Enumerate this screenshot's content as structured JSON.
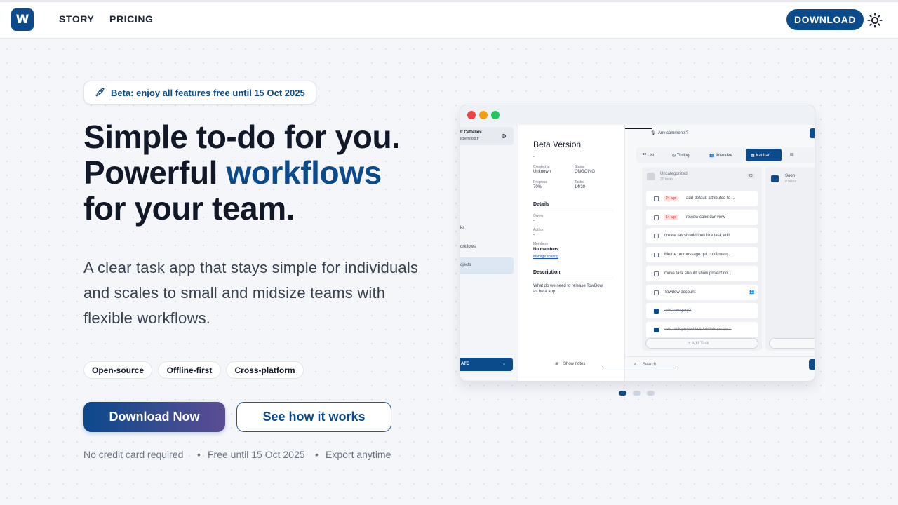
{
  "header": {
    "logo_letter": "W",
    "nav": [
      "STORY",
      "PRICING"
    ],
    "download_label": "DOWNLOAD",
    "theme_icon": "sun-icon"
  },
  "hero": {
    "badge_icon": "rocket-icon",
    "badge_text": "Beta: enjoy all features free until 15 Oct 2025",
    "title_line1": "Simple to-do for you.",
    "title_line2_a": "Powerful ",
    "title_line2_b": "workflows",
    "title_line3": "for your team.",
    "subtitle": "A clear task app that stays simple for individuals and scales to small and midsize teams with flexible workflows.",
    "chips": [
      "Open-source",
      "Offline-first",
      "Cross-platform"
    ],
    "primary_cta": "Download Now",
    "secondary_cta": "See how it works",
    "notes": [
      "No credit card required",
      "Free until 15 Oct 2025",
      "Export anytime"
    ],
    "note_separator": "•"
  },
  "app_preview": {
    "sidebar": {
      "user_name": "lt Cattelani",
      "user_email": "j@emocio.fr",
      "items": [
        "ks",
        "orkflows",
        "ojects"
      ],
      "create_label": "ATE"
    },
    "detail": {
      "title": "Beta Version",
      "dash": "-",
      "created_label": "Created at",
      "created_value": "Unknown",
      "status_label": "Status",
      "status_value": "ONGOING",
      "progress_label": "Progress",
      "progress_value": "70%",
      "tasks_label": "Tasks",
      "tasks_value": "14/20",
      "details_heading": "Details",
      "owner_label": "Owner",
      "owner_value": "-",
      "author_label": "Author",
      "author_value": "-",
      "members_label": "Members",
      "members_value": "No members",
      "manage_link": "Manage sharing",
      "description_heading": "Description",
      "description_text": "What do we need to release TowDow as beta app",
      "show_notes": "Show notes"
    },
    "board": {
      "comments_placeholder": "Any comments?",
      "views": [
        "List",
        "Timing",
        "Attendee",
        "Kanban"
      ],
      "active_view": "Kanban",
      "col1_title": "Uncategorized",
      "col1_count_text": "20 tasks",
      "col1_count_badge": "20",
      "tasks": [
        {
          "title": "add default attributed to ...",
          "tag": "24 ago",
          "done": false
        },
        {
          "title": "review calendar view",
          "tag": "14 ago",
          "done": false
        },
        {
          "title": "create tas should look like task edit",
          "tag": "",
          "done": false
        },
        {
          "title": "Mettre un message qui confirme q...",
          "tag": "",
          "done": false
        },
        {
          "title": "move task should show project do...",
          "tag": "",
          "done": false
        },
        {
          "title": "Towdow account",
          "tag": "",
          "done": false
        },
        {
          "title": "add category?",
          "tag": "",
          "done": true
        },
        {
          "title": "add task project link inb homescre...",
          "tag": "",
          "done": true
        }
      ],
      "add_task": "+ Add Task",
      "col2_title": "Soon",
      "col2_count_text": "0 tasks",
      "search_placeholder": "Search"
    }
  },
  "carousel": {
    "count": 3,
    "active": 1
  },
  "colors": {
    "brand": "#0b4a8b",
    "accent_end": "#5b4d94",
    "background": "#f4f6fa"
  }
}
